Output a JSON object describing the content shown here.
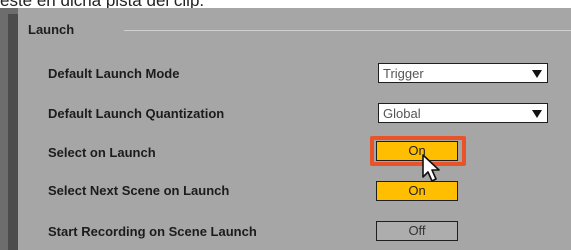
{
  "caption": "este en dicha pista del clip.",
  "group": {
    "title": "Launch"
  },
  "rows": [
    {
      "label": "Default Launch Mode",
      "control": "dropdown",
      "value": "Trigger"
    },
    {
      "label": "Default Launch Quantization",
      "control": "dropdown",
      "value": "Global"
    },
    {
      "label": "Select on Launch",
      "control": "toggle",
      "value": "On",
      "state": "on",
      "focused": true
    },
    {
      "label": "Select Next Scene on Launch",
      "control": "toggle",
      "value": "On",
      "state": "on"
    },
    {
      "label": "Start Recording on Scene Launch",
      "control": "toggle",
      "value": "Off",
      "state": "off"
    }
  ],
  "icons": [
    "chevron-down-icon",
    "mouse-pointer-icon"
  ],
  "colors": {
    "toggle_on": "#ffbf00",
    "focus_ring": "#e8532a",
    "panel": "#a6a6a6"
  }
}
